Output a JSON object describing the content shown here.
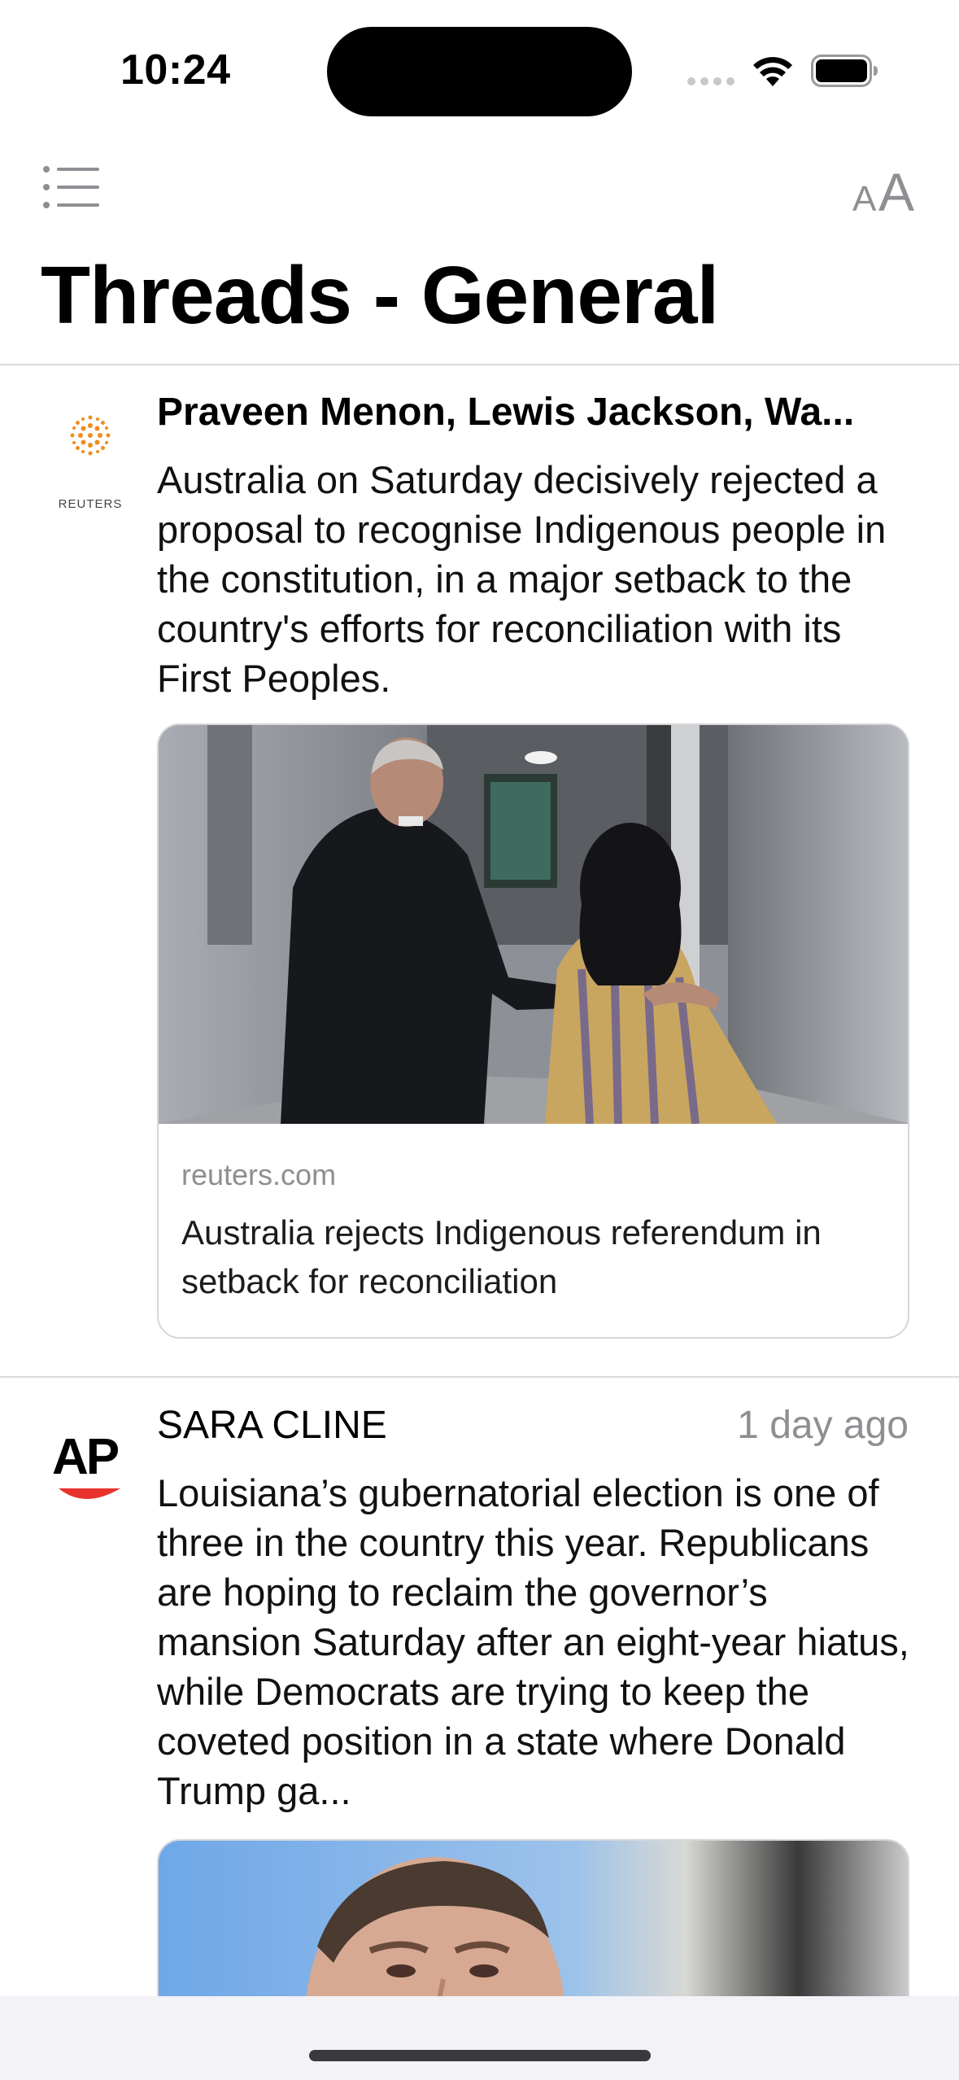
{
  "status": {
    "time": "10:24"
  },
  "header": {
    "title": "Threads - General",
    "font_button_small": "A",
    "font_button_large": "A"
  },
  "items": [
    {
      "source": "REUTERS",
      "author": "Praveen Menon, Lewis Jackson, Wa...",
      "time_ago": "",
      "summary": "Australia on Saturday decisively rejected a proposal to recognise Indigenous people in the constitution, in a major setback to the country's efforts for reconciliation with its First Peoples.",
      "card": {
        "domain": "reuters.com",
        "headline": "Australia rejects Indigenous referendum in setback for reconciliation"
      }
    },
    {
      "source": "AP",
      "author": "SARA CLINE",
      "time_ago": "1 day ago",
      "summary": "Louisiana’s gubernatorial election is one of three in the country this year. Republicans are hoping to reclaim the governor’s mansion Saturday after an eight-year hiatus, while Democrats are trying to keep the coveted position in a state where Donald Trump ga..."
    }
  ],
  "colors": {
    "accent_reuters": "#f08c1e",
    "ap_red": "#e8322c",
    "secondary_text": "#8e8e93"
  }
}
